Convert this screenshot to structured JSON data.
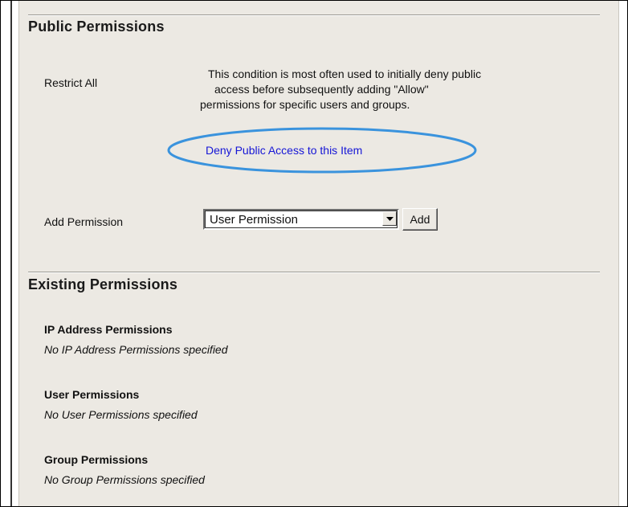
{
  "public_permissions": {
    "title": "Public Permissions",
    "restrict_all_label": "Restrict All",
    "description": [
      "This condition is most often used to initially deny public",
      "access before subsequently adding \"Allow\"",
      "permissions for specific users and groups."
    ],
    "deny_link": "Deny Public Access to this Item",
    "highlight_color": "#3a93dd"
  },
  "add_permission": {
    "label": "Add Permission",
    "selected": "User Permission",
    "button": "Add"
  },
  "existing_permissions": {
    "title": "Existing Permissions",
    "groups": [
      {
        "title": "IP Address Permissions",
        "empty_text": "No IP Address Permissions specified"
      },
      {
        "title": "User Permissions",
        "empty_text": "No User Permissions specified"
      },
      {
        "title": "Group Permissions",
        "empty_text": "No Group Permissions specified"
      }
    ]
  }
}
